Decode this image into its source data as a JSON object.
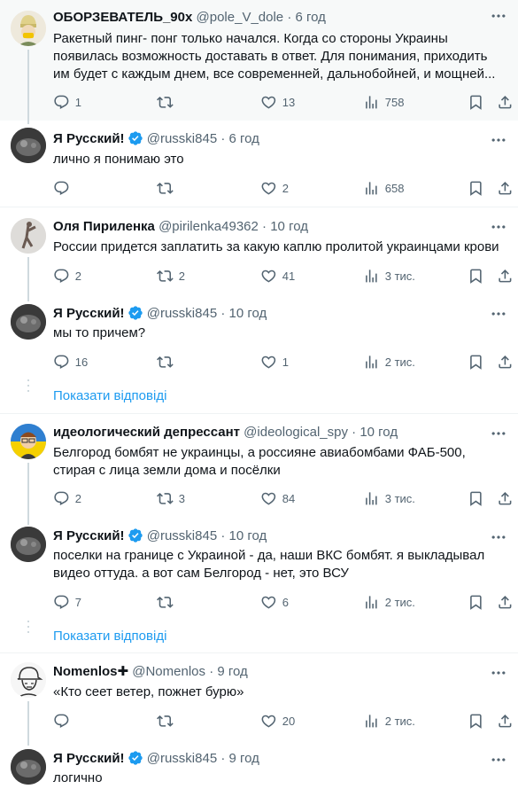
{
  "tweets": [
    {
      "name": "ОБОРЗЕВАТЕЛЬ_90х",
      "handle": "@pole_V_dole",
      "time": "6 год",
      "verified": false,
      "text": "Ракетный пинг- понг только начался. Когда со стороны Украины появилась возможность доставать в ответ. Для понимания, приходить им будет с каждым днем, все современней, дальнобойней, и мощней...",
      "replies": "1",
      "retweets": "",
      "likes": "13",
      "views": "758"
    },
    {
      "name": "Я Русский!",
      "handle": "@russki845",
      "time": "6 год",
      "verified": true,
      "text": "лично я понимаю это",
      "replies": "",
      "retweets": "",
      "likes": "2",
      "views": "658"
    },
    {
      "name": "Оля Пириленка",
      "handle": "@pirilenka49362",
      "time": "10 год",
      "verified": false,
      "text": "России придется заплатить за какую каплю пролитой украинцами крови",
      "replies": "2",
      "retweets": "2",
      "likes": "41",
      "views": "3 тис."
    },
    {
      "name": "Я Русский!",
      "handle": "@russki845",
      "time": "10 год",
      "verified": true,
      "text": "мы то причем?",
      "replies": "16",
      "retweets": "",
      "likes": "1",
      "views": "2 тис."
    },
    {
      "name": "идеологический депрессант",
      "handle": "@ideological_spy",
      "time": "10 год",
      "verified": false,
      "text": "Белгород бомбят не украинцы, а россияне авиабомбами ФАБ-500, стирая с лица земли дома и посёлки",
      "replies": "2",
      "retweets": "3",
      "likes": "84",
      "views": "3 тис."
    },
    {
      "name": "Я Русский!",
      "handle": "@russki845",
      "time": "10 год",
      "verified": true,
      "text": "поселки на границе с Украиной - да, наши ВКС бомбят. я выкладывал видео оттуда. а вот сам Белгород - нет, это ВСУ",
      "replies": "7",
      "retweets": "",
      "likes": "6",
      "views": "2 тис."
    },
    {
      "name": "Nomenlos✚",
      "handle": "@Nomenlos",
      "time": "9 год",
      "verified": false,
      "text": "«Кто сеет ветер, пожнет бурю»",
      "replies": "",
      "retweets": "",
      "likes": "20",
      "views": "2 тис."
    },
    {
      "name": "Я Русский!",
      "handle": "@russki845",
      "time": "9 год",
      "verified": true,
      "text": "логично",
      "replies": "",
      "retweets": "",
      "likes": "",
      "views": ""
    }
  ],
  "show_replies_label": "Показати відповіді",
  "colors": {
    "accent": "#1d9bf0",
    "secondary_text": "#536471",
    "border": "#eff3f4",
    "highlight_bg": "#f7f9f9"
  },
  "icons": [
    "reply-icon",
    "retweet-icon",
    "like-icon",
    "views-icon",
    "bookmark-icon",
    "share-icon",
    "more-icon",
    "verified-badge-icon"
  ]
}
